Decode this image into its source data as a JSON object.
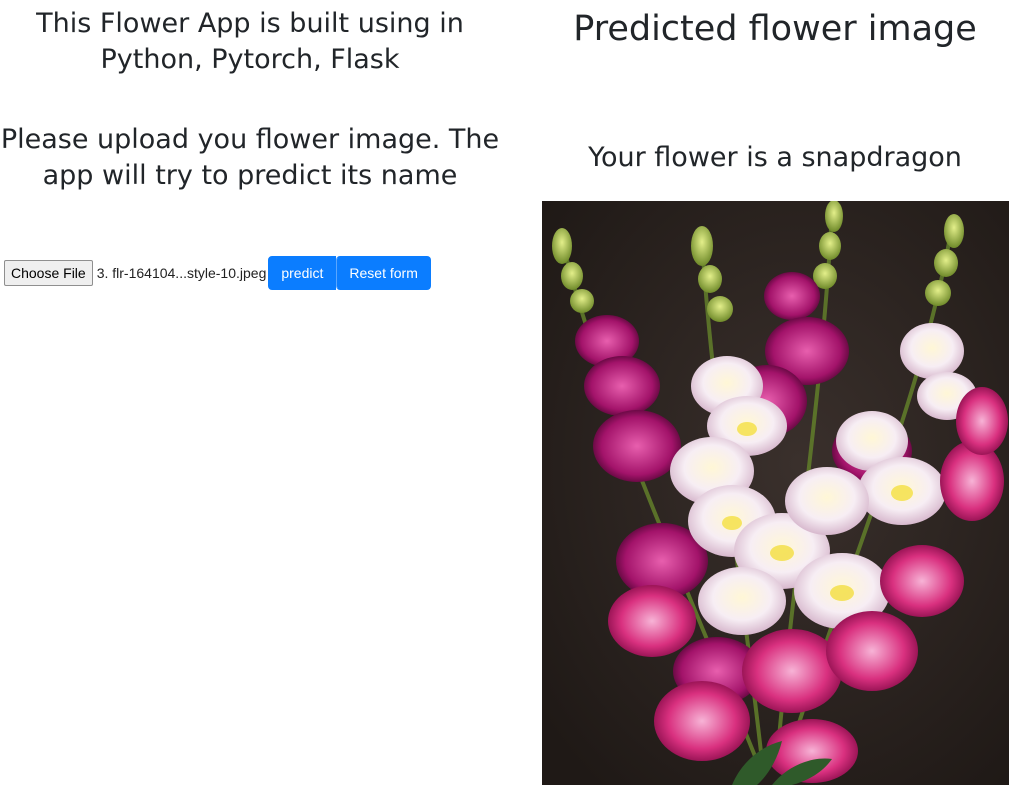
{
  "left": {
    "app_title": "This Flower App is built using in Python, Pytorch, Flask",
    "instructions": "Please upload you flower image. The app will try to predict its name",
    "upload": {
      "choose_file_label": "Choose File",
      "file_name": "3. flr-164104...style-10.jpeg",
      "predict_label": "predict",
      "reset_label": "Reset form"
    }
  },
  "right": {
    "heading": "Predicted flower image",
    "result": "Your flower is a snapdragon"
  },
  "colors": {
    "primary_button": "#0b7dff",
    "text": "#212529",
    "photo_background": "#2f2724"
  },
  "icons": {
    "flower_photo": "snapdragon-photo"
  }
}
